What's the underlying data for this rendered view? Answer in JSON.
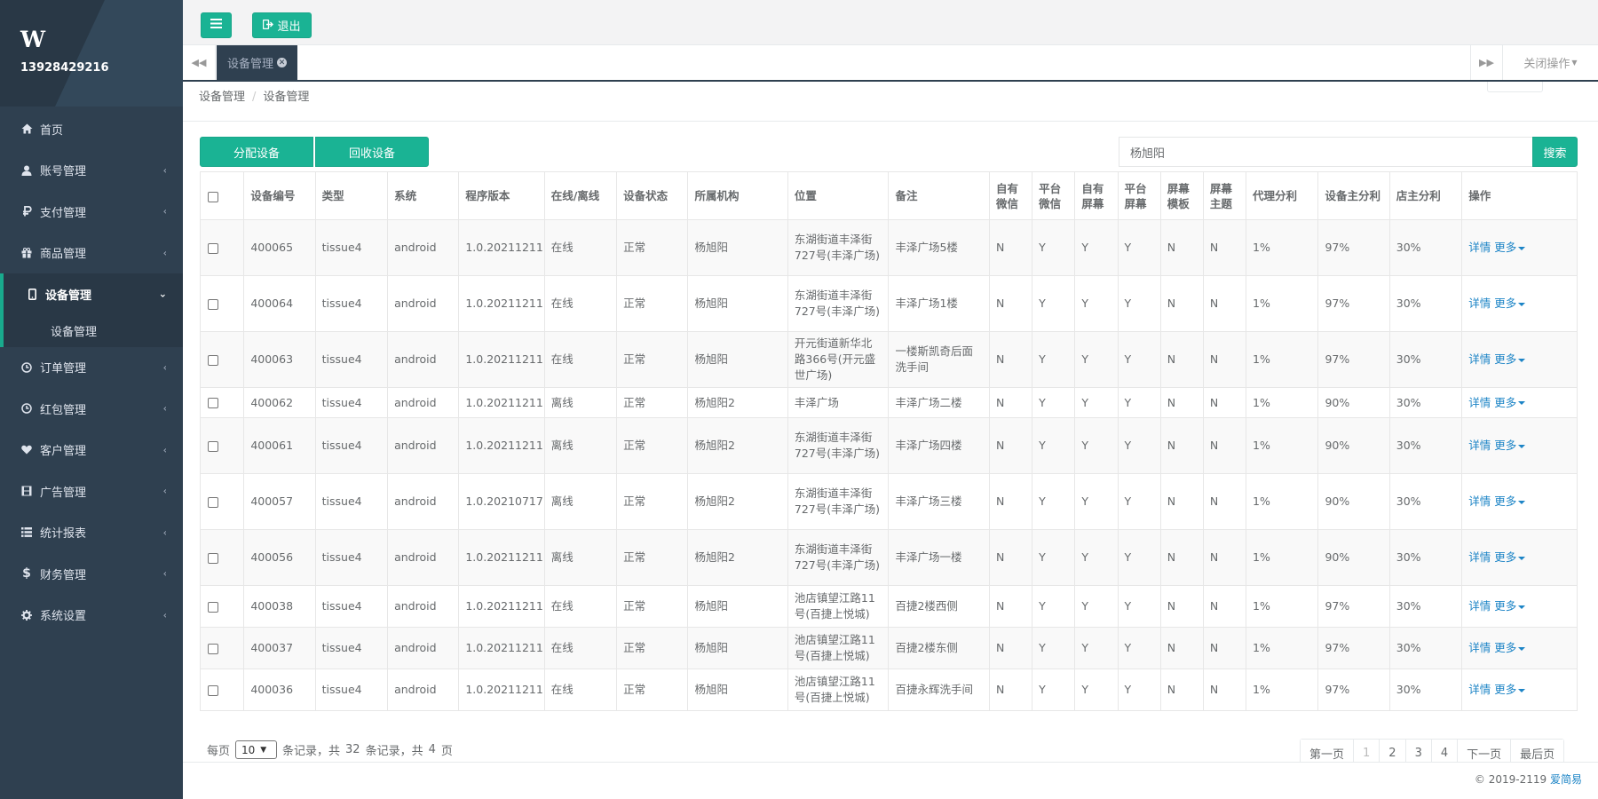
{
  "sidebar": {
    "logo": "W",
    "user": "13928429216",
    "items": [
      {
        "label": "首页",
        "icon": "home-icon"
      },
      {
        "label": "账号管理",
        "icon": "user-icon"
      },
      {
        "label": "支付管理",
        "icon": "ruble-icon"
      },
      {
        "label": "商品管理",
        "icon": "gift-icon"
      },
      {
        "label": "设备管理",
        "icon": "mobile-icon",
        "sub": "设备管理"
      },
      {
        "label": "订单管理",
        "icon": "clock-icon"
      },
      {
        "label": "红包管理",
        "icon": "clock-icon"
      },
      {
        "label": "客户管理",
        "icon": "heart-icon"
      },
      {
        "label": "广告管理",
        "icon": "film-icon"
      },
      {
        "label": "统计报表",
        "icon": "list-icon"
      },
      {
        "label": "财务管理",
        "icon": "dollar-icon"
      },
      {
        "label": "系统设置",
        "icon": "gear-icon"
      }
    ]
  },
  "topbar": {
    "logout_label": "退出"
  },
  "tabs": {
    "active": "设备管理",
    "close_ops": "关闭操作"
  },
  "breadcrumb": [
    "设备管理",
    "设备管理"
  ],
  "toolbar": {
    "assign_label": "分配设备",
    "recycle_label": "回收设备",
    "search_value": "杨旭阳",
    "search_label": "搜索"
  },
  "table": {
    "headers": [
      "设备编号",
      "类型",
      "系统",
      "程序版本",
      "在线/离线",
      "设备状态",
      "所属机构",
      "位置",
      "备注",
      "自有微信",
      "平台微信",
      "自有屏幕",
      "平台屏幕",
      "屏幕模板",
      "屏幕主题",
      "代理分利",
      "设备主分利",
      "店主分利",
      "操作"
    ],
    "ops_detail": "详情",
    "ops_more": "更多",
    "rows": [
      [
        "400065",
        "tissue4",
        "android",
        "1.0.20211211",
        "在线",
        "正常",
        "杨旭阳",
        "东湖街道丰泽街727号(丰泽广场)",
        "丰泽广场5楼",
        "N",
        "Y",
        "Y",
        "Y",
        "N",
        "N",
        "1%",
        "97%",
        "30%"
      ],
      [
        "400064",
        "tissue4",
        "android",
        "1.0.20211211",
        "在线",
        "正常",
        "杨旭阳",
        "东湖街道丰泽街727号(丰泽广场)",
        "丰泽广场1楼",
        "N",
        "Y",
        "Y",
        "Y",
        "N",
        "N",
        "1%",
        "97%",
        "30%"
      ],
      [
        "400063",
        "tissue4",
        "android",
        "1.0.20211211",
        "在线",
        "正常",
        "杨旭阳",
        "开元街道新华北路366号(开元盛世广场)",
        "一楼斯凯奇后面洗手间",
        "N",
        "Y",
        "Y",
        "Y",
        "N",
        "N",
        "1%",
        "97%",
        "30%"
      ],
      [
        "400062",
        "tissue4",
        "android",
        "1.0.20211211",
        "离线",
        "正常",
        "杨旭阳2",
        "丰泽广场",
        "丰泽广场二楼",
        "N",
        "Y",
        "Y",
        "Y",
        "N",
        "N",
        "1%",
        "90%",
        "30%"
      ],
      [
        "400061",
        "tissue4",
        "android",
        "1.0.20211211",
        "离线",
        "正常",
        "杨旭阳2",
        "东湖街道丰泽街727号(丰泽广场)",
        "丰泽广场四楼",
        "N",
        "Y",
        "Y",
        "Y",
        "N",
        "N",
        "1%",
        "90%",
        "30%"
      ],
      [
        "400057",
        "tissue4",
        "android",
        "1.0.20210717",
        "离线",
        "正常",
        "杨旭阳2",
        "东湖街道丰泽街727号(丰泽广场)",
        "丰泽广场三楼",
        "N",
        "Y",
        "Y",
        "Y",
        "N",
        "N",
        "1%",
        "90%",
        "30%"
      ],
      [
        "400056",
        "tissue4",
        "android",
        "1.0.20211211",
        "离线",
        "正常",
        "杨旭阳2",
        "东湖街道丰泽街727号(丰泽广场)",
        "丰泽广场一楼",
        "N",
        "Y",
        "Y",
        "Y",
        "N",
        "N",
        "1%",
        "90%",
        "30%"
      ],
      [
        "400038",
        "tissue4",
        "android",
        "1.0.20211211",
        "在线",
        "正常",
        "杨旭阳",
        "池店镇望江路11号(百捷上悦城)",
        "百捷2楼西侧",
        "N",
        "Y",
        "Y",
        "Y",
        "N",
        "N",
        "1%",
        "97%",
        "30%"
      ],
      [
        "400037",
        "tissue4",
        "android",
        "1.0.20211211",
        "在线",
        "正常",
        "杨旭阳",
        "池店镇望江路11号(百捷上悦城)",
        "百捷2楼东侧",
        "N",
        "Y",
        "Y",
        "Y",
        "N",
        "N",
        "1%",
        "97%",
        "30%"
      ],
      [
        "400036",
        "tissue4",
        "android",
        "1.0.20211211",
        "在线",
        "正常",
        "杨旭阳",
        "池店镇望江路11号(百捷上悦城)",
        "百捷永辉洗手间",
        "N",
        "Y",
        "Y",
        "Y",
        "N",
        "N",
        "1%",
        "97%",
        "30%"
      ]
    ]
  },
  "pager": {
    "per_page_label": "每页",
    "page_size": "10",
    "records_label": "条记录，共",
    "total_records": "32",
    "records_label2": "条记录，共",
    "total_pages": "4",
    "pages_label": "页",
    "buttons": [
      "第一页",
      "1",
      "2",
      "3",
      "4",
      "下一页",
      "最后页"
    ]
  },
  "footer": {
    "copyright": "© 2019-2119",
    "brand": "爱简易"
  }
}
